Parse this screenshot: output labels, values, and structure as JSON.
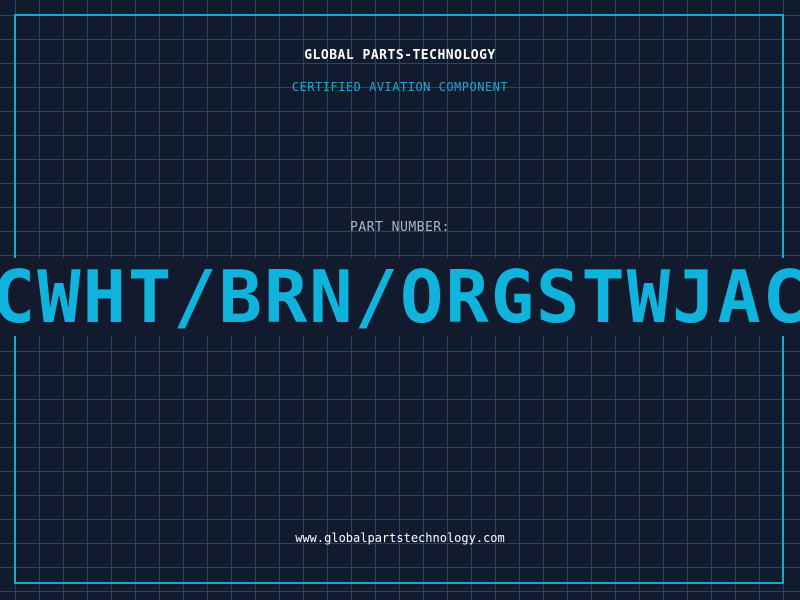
{
  "header": {
    "company": "GLOBAL PARTS-TECHNOLOGY",
    "subtitle": "CERTIFIED AVIATION COMPONENT"
  },
  "part": {
    "label": "PART NUMBER:",
    "number": "CWHT/BRN/ORGSTWJAC"
  },
  "footer": {
    "website": "www.globalpartstechnology.com"
  },
  "colors": {
    "background": "#121a2e",
    "grid": "#1e4a66",
    "accent": "#10b3dc",
    "frame": "#1ea5cf"
  }
}
